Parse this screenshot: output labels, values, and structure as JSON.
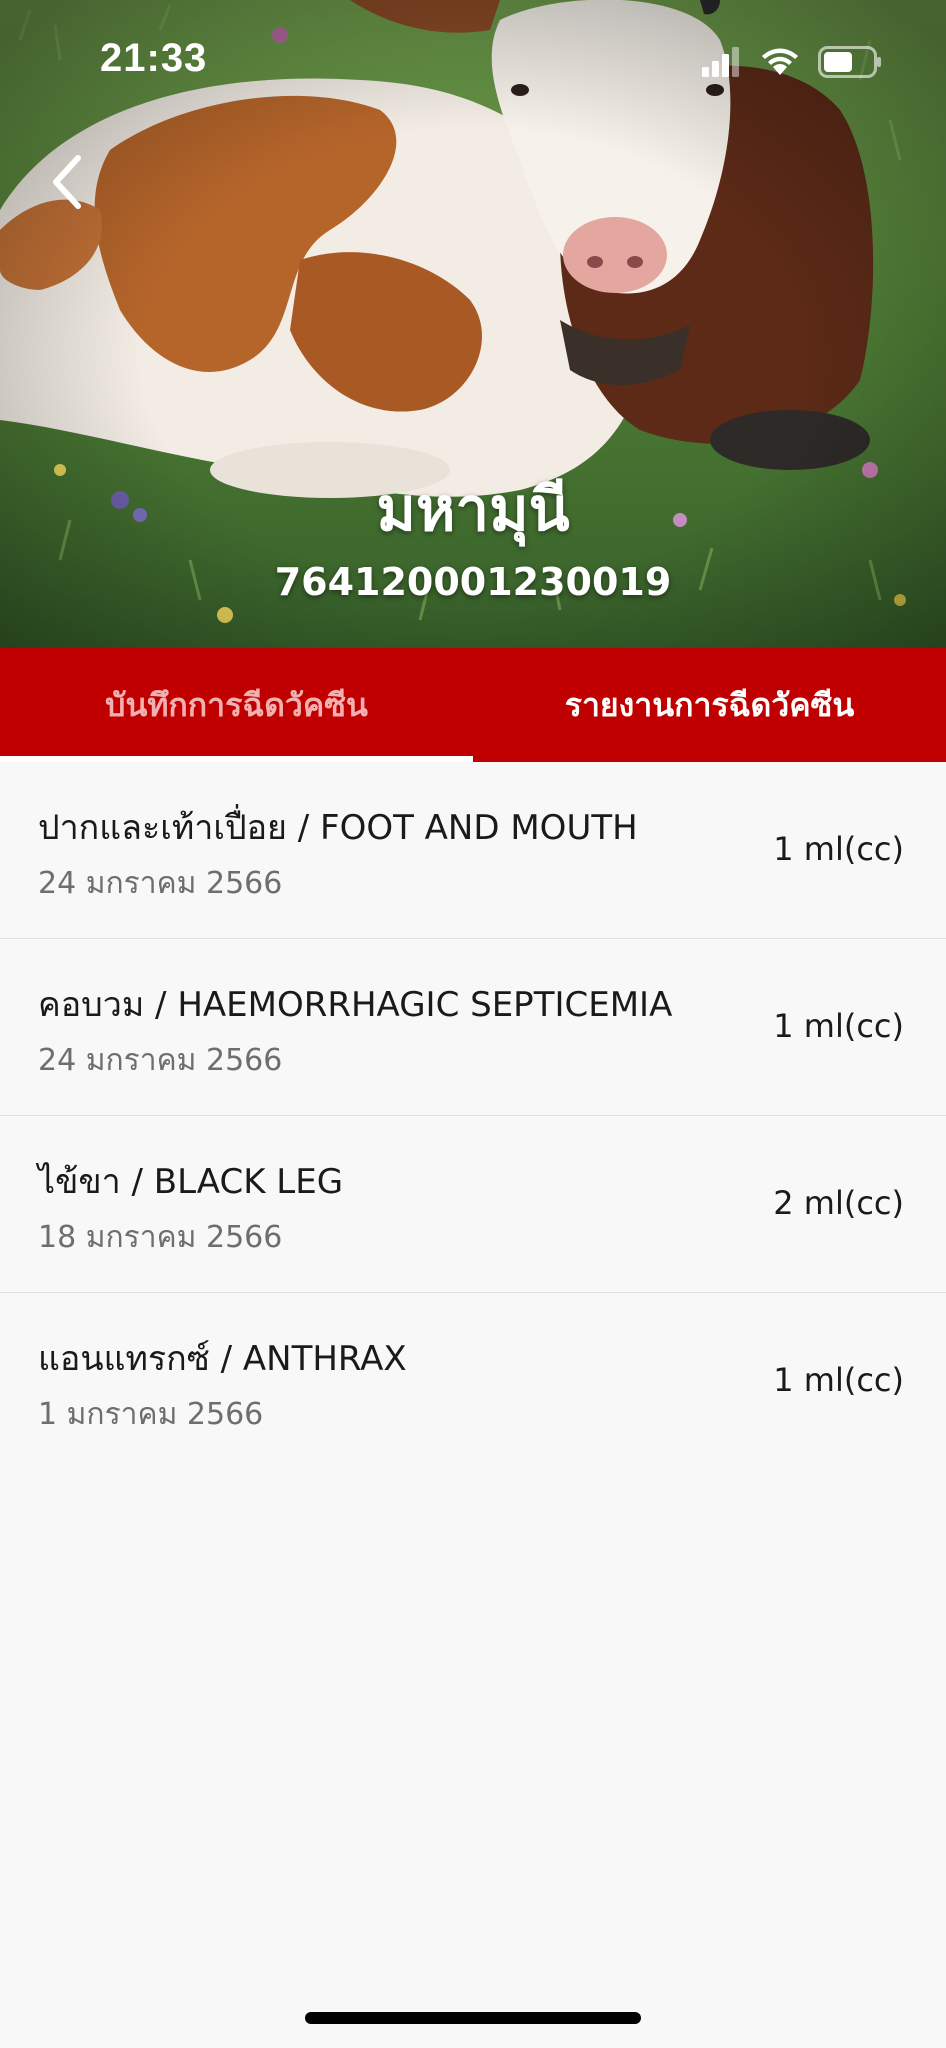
{
  "status_bar": {
    "time": "21:33",
    "icons": [
      "signal-icon",
      "wifi-icon",
      "battery-icon"
    ]
  },
  "header": {
    "back_icon": "chevron-left-icon",
    "animal_name": "มหามุนี",
    "animal_id": "764120001230019"
  },
  "tabs": [
    {
      "label": "บันทึกการฉีดวัคซีน",
      "active": false
    },
    {
      "label": "รายงานการฉีดวัคซีน",
      "active": true
    }
  ],
  "vaccinations": [
    {
      "name": "ปากและเท้าเปื่อย / FOOT AND MOUTH",
      "date": "24 มกราคม 2566",
      "dose": "1 ml(cc)"
    },
    {
      "name": "คอบวม / HAEMORRHAGIC SEPTICEMIA",
      "date": "24 มกราคม 2566",
      "dose": "1 ml(cc)"
    },
    {
      "name": "ไข้ขา / BLACK LEG",
      "date": "18 มกราคม 2566",
      "dose": "2 ml(cc)"
    },
    {
      "name": "แอนแทรกซ์ / ANTHRAX",
      "date": "1 มกราคม 2566",
      "dose": "1 ml(cc)"
    }
  ],
  "colors": {
    "tab_bar": "#c00000",
    "tab_inactive_text": "#f3b0b0",
    "tab_active_text": "#ffffff",
    "background": "#f8f8f8"
  }
}
